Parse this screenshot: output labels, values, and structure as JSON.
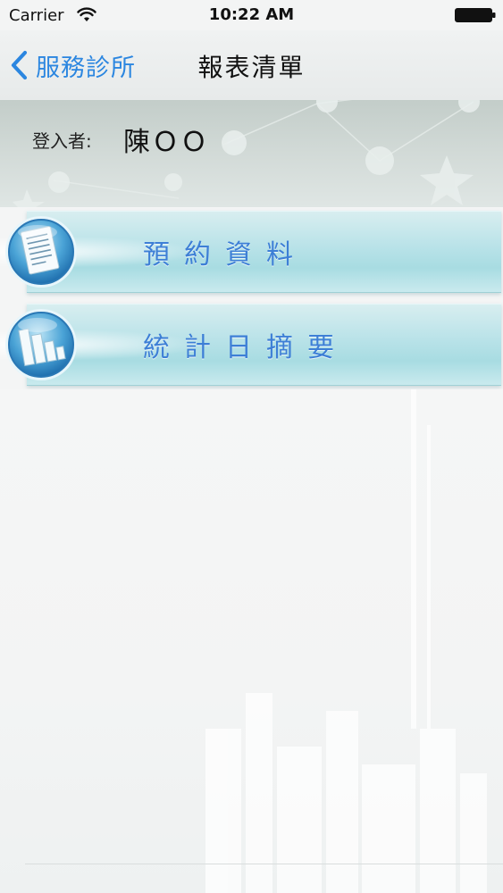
{
  "status_bar": {
    "carrier": "Carrier",
    "time": "10:22 AM"
  },
  "nav": {
    "back_label": "服務診所",
    "title": "報表清單"
  },
  "user": {
    "label": "登入者:",
    "name": "陳ＯＯ"
  },
  "menu": {
    "items": [
      {
        "label": "預約資料",
        "icon": "document-icon"
      },
      {
        "label": "統計日摘要",
        "icon": "bar-chart-icon"
      }
    ]
  },
  "colors": {
    "accent": "#2b86e0",
    "menu_text": "#3d7fd6",
    "menu_bg": "#b8e2e8"
  }
}
